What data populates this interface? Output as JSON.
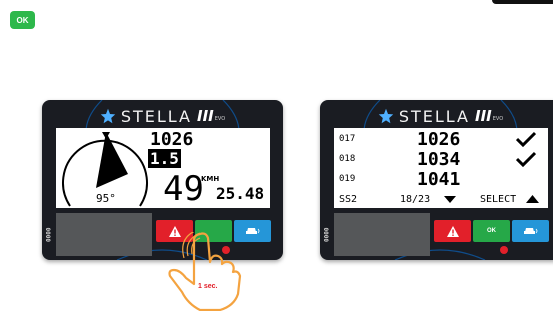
{
  "badge": {
    "label": "OK"
  },
  "colors": {
    "ok_green": "#26a848",
    "warn_red": "#e2202a",
    "car_blue": "#2596d8",
    "bezel": "#1a1c22",
    "hand_orange": "#f4a340"
  },
  "device_left": {
    "brand": {
      "name": "STELLA",
      "mark": "III",
      "edition": "EVO"
    },
    "side_label": "0000",
    "screen": {
      "time_top": "1026",
      "time_highlight": "1.5",
      "speed": "49",
      "speed_unit": "KMH",
      "distance": "25.48",
      "heading_angle": "95°"
    },
    "buttons": {
      "warn_icon": "warning-triangle-icon",
      "ok_label": "OK",
      "car_icon": "car-icon"
    }
  },
  "device_right": {
    "brand": {
      "name": "STELLA",
      "mark": "III",
      "edition": "EVO"
    },
    "side_label": "0000",
    "screen": {
      "rows": [
        {
          "num": "017",
          "time": "1026",
          "check": true
        },
        {
          "num": "018",
          "time": "1034",
          "check": true
        },
        {
          "num": "019",
          "time": "1041",
          "check": false
        }
      ],
      "footer": {
        "stage": "SS2",
        "page": "18/23",
        "select": "SELECT"
      }
    },
    "buttons": {
      "warn_icon": "warning-triangle-icon",
      "ok_label": "OK",
      "car_icon": "car-icon"
    }
  },
  "gesture": {
    "hold_label": "1 sec."
  }
}
